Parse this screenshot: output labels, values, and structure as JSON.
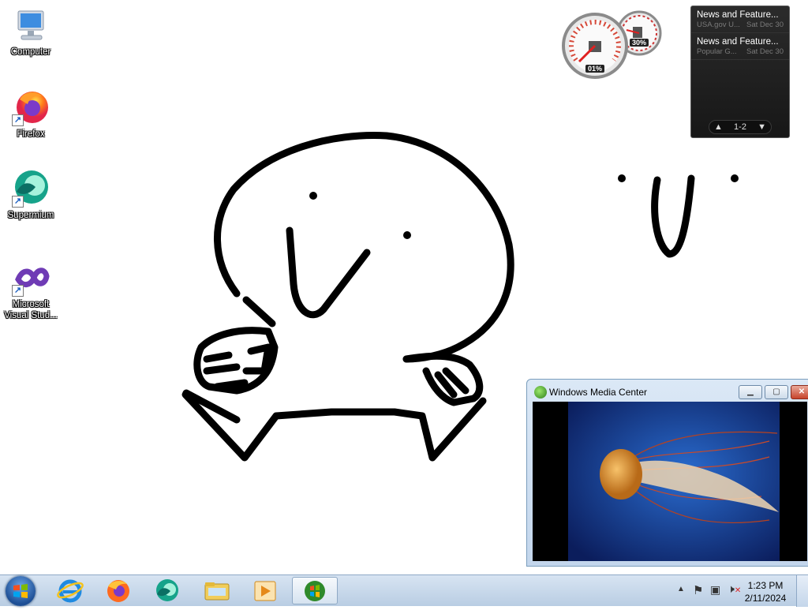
{
  "desktop": {
    "icons": [
      {
        "label": "Computer",
        "icon": "computer-icon"
      },
      {
        "label": "Firefox",
        "icon": "firefox-icon"
      },
      {
        "label": "Supermium",
        "icon": "supermium-icon"
      },
      {
        "label": "Microsoft Visual Stud...",
        "icon": "visual-studio-icon"
      }
    ]
  },
  "gadgets": {
    "cpu_meter": {
      "cpu_label": "01%",
      "memory_label": "30%"
    },
    "news": {
      "items": [
        {
          "title": "News and Feature...",
          "source": "USA.gov U...",
          "date": "Sat Dec 30"
        },
        {
          "title": "News and Feature...",
          "source": "Popular G...",
          "date": "Sat Dec 30"
        }
      ],
      "pager": "1-2"
    }
  },
  "media_center": {
    "title": "Windows Media Center"
  },
  "taskbar": {
    "pinned": [
      "internet-explorer-icon",
      "firefox-icon",
      "supermium-icon",
      "windows-explorer-icon",
      "media-player-icon",
      "media-center-icon"
    ],
    "clock": {
      "time": "1:23 PM",
      "date": "2/11/2024"
    }
  },
  "colors": {
    "taskbar": "#c5d6e9",
    "gadget_bg": "#1e1e1e",
    "accent": "#1e4f95"
  }
}
